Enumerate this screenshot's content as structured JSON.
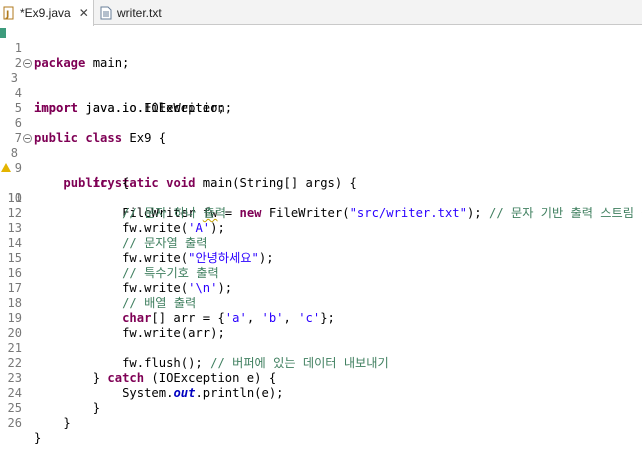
{
  "tabs": [
    {
      "label": "*Ex9.java",
      "icon": "java-file-icon",
      "active": true
    },
    {
      "label": "writer.txt",
      "icon": "text-file-icon",
      "active": false
    }
  ],
  "code": {
    "l1": {
      "n": "1",
      "kw": "package",
      "rest": " main;"
    },
    "l3": {
      "n": "3",
      "kw": "import",
      "rest": " java.io.FileWriter;"
    },
    "l4": {
      "n": "4",
      "kw": "import",
      "rest": " java.io.IOException;"
    },
    "l6": {
      "n": "6",
      "kw1": "public",
      "kw2": "class",
      "rest": " Ex9 {"
    },
    "l8": {
      "n": "8",
      "indent": "    ",
      "kw1": "public",
      "kw2": "static",
      "kw3": "void",
      "rest": " main(String[] args) {"
    },
    "l9": {
      "n": "9",
      "indent": "        ",
      "kw": "try",
      "rest": " {"
    },
    "l10": {
      "n": "10",
      "indent": "            ",
      "a": "FileWriter ",
      "var": "fw",
      "b": " = ",
      "kw": "new",
      "c": " FileWriter(",
      "str": "\"src/writer.txt\"",
      "d": "); ",
      "cm": "// 문자 기반 출력 스트림 생성"
    },
    "l11": {
      "n": "11",
      "indent": "            ",
      "cm": "// 문자 하나 출력"
    },
    "l12": {
      "n": "12",
      "indent": "            ",
      "a": "fw.write(",
      "str": "'A'",
      "b": ");"
    },
    "l13": {
      "n": "13",
      "indent": "            ",
      "cm": "// 문자열 출력"
    },
    "l14": {
      "n": "14",
      "indent": "            ",
      "a": "fw.write(",
      "str": "\"안녕하세요\"",
      "b": ");"
    },
    "l15": {
      "n": "15",
      "indent": "            ",
      "cm": "// 특수기호 출력"
    },
    "l16": {
      "n": "16",
      "indent": "            ",
      "a": "fw.write(",
      "str": "'\\n'",
      "b": ");"
    },
    "l17": {
      "n": "17",
      "indent": "            ",
      "cm": "// 배열 출력"
    },
    "l18": {
      "n": "18",
      "indent": "            ",
      "kw": "char",
      "a": "[] arr = {",
      "s1": "'a'",
      "b": ", ",
      "s2": "'b'",
      "c": ", ",
      "s3": "'c'",
      "d": "};"
    },
    "l19": {
      "n": "19",
      "indent": "            ",
      "a": "fw.write(arr);"
    },
    "l20": {
      "n": "20"
    },
    "l21": {
      "n": "21",
      "indent": "            ",
      "a": "fw.flush(); ",
      "cm": "// 버퍼에 있는 데이터 내보내기"
    },
    "l22": {
      "n": "22",
      "indent": "        ",
      "a": "} ",
      "kw": "catch",
      "b": " (IOException e) {"
    },
    "l23": {
      "n": "23",
      "indent": "            ",
      "a": "System.",
      "it": "out",
      "b": ".println(e);"
    },
    "l24": {
      "n": "24",
      "indent": "        ",
      "a": "}"
    },
    "l25": {
      "n": "25",
      "indent": "    ",
      "a": "}"
    },
    "l26": {
      "n": "26",
      "a": "}"
    },
    "l2": {
      "n": "2"
    },
    "l5": {
      "n": "5"
    },
    "l7": {
      "n": "7"
    }
  },
  "colors": {
    "keyword": "#7f0055",
    "string": "#2a00ff",
    "comment": "#3f7f5f",
    "field": "#0000c0"
  }
}
